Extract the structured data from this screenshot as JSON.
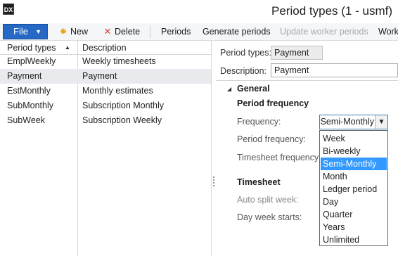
{
  "window": {
    "title": "Period types (1 - usmf)",
    "app_icon_text": "DX"
  },
  "ribbon": {
    "file_label": "File",
    "new_label": "New",
    "delete_label": "Delete",
    "periods_label": "Periods",
    "generate_periods_label": "Generate periods",
    "update_worker_periods_label": "Update worker periods",
    "workers_label_truncated": "Work"
  },
  "grid": {
    "columns": [
      "Period types",
      "Description"
    ],
    "rows": [
      {
        "period_type": "EmplWeekly",
        "description": "Weekly timesheets"
      },
      {
        "period_type": "Payment",
        "description": "Payment"
      },
      {
        "period_type": "EstMonthly",
        "description": "Monthly estimates"
      },
      {
        "period_type": "SubMonthly",
        "description": "Subscription Monthly"
      },
      {
        "period_type": "SubWeek",
        "description": "Subscription Weekly"
      }
    ],
    "selected_index": 1
  },
  "details": {
    "period_types_label": "Period types:",
    "period_types_value": "Payment",
    "description_label": "Description:",
    "description_value": "Payment",
    "general_header": "General",
    "period_frequency_header": "Period frequency",
    "frequency_label": "Frequency:",
    "frequency_value": "Semi-Monthly",
    "period_frequency_label": "Period frequency:",
    "timesheet_frequency_label": "Timesheet frequency:",
    "timesheet_header": "Timesheet",
    "auto_split_week_label": "Auto split week:",
    "day_week_starts_label": "Day week starts:"
  },
  "dropdown": {
    "options": [
      "Week",
      "Bi-weekly",
      "Semi-Monthly",
      "Month",
      "Ledger period",
      "Day",
      "Quarter",
      "Years",
      "Unlimited"
    ],
    "highlighted_index": 2
  },
  "colors": {
    "accent": "#2568c5",
    "highlight": "#3399ff"
  },
  "icons": {
    "new": "sun-star-icon",
    "delete": "red-x-icon"
  }
}
